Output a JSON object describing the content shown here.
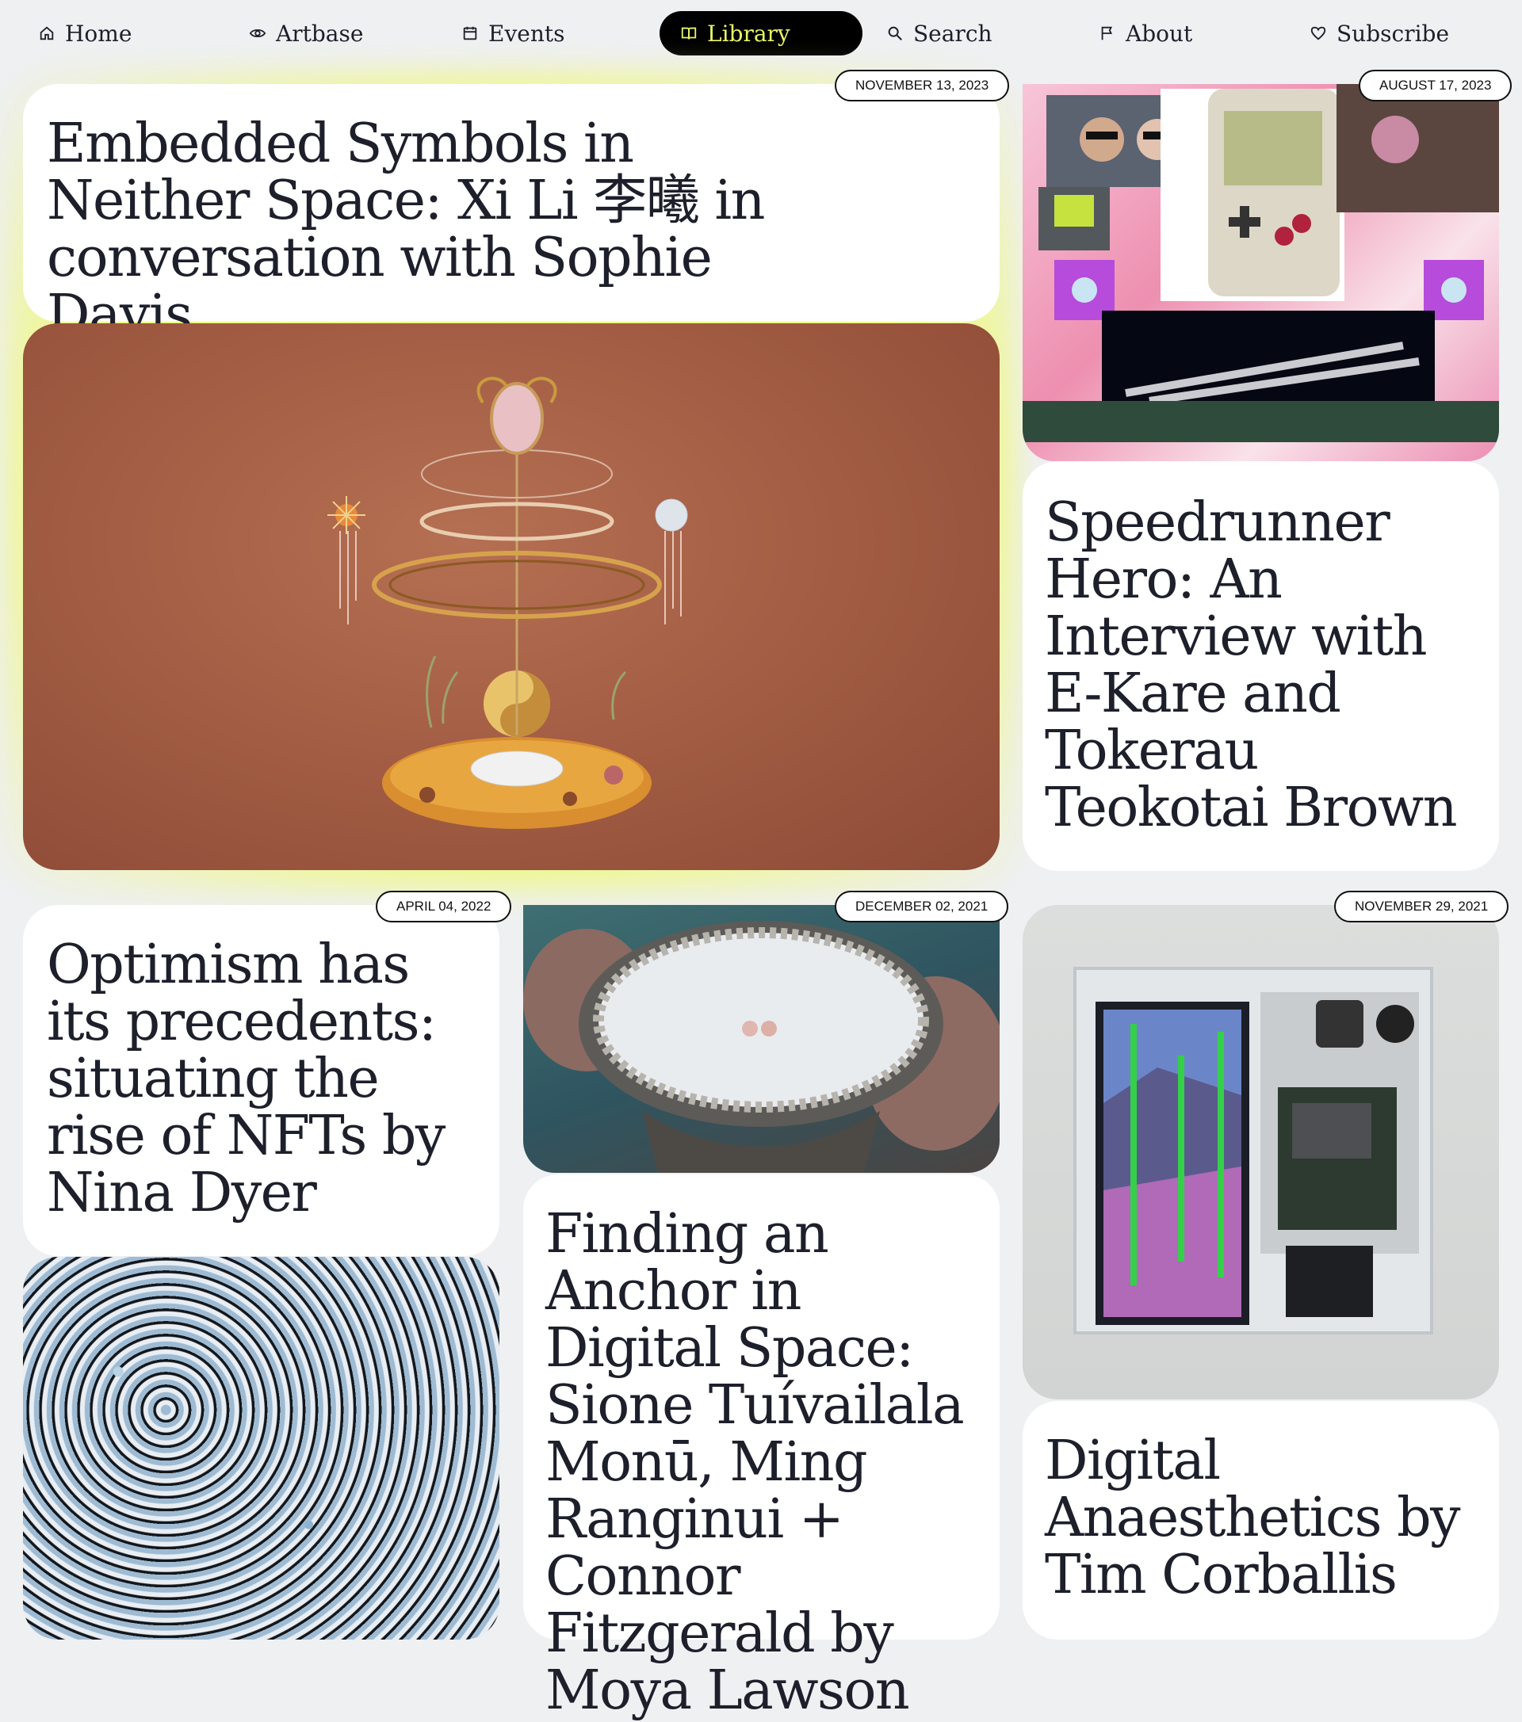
{
  "nav": {
    "items": [
      {
        "label": "Home",
        "icon": "home-icon"
      },
      {
        "label": "Artbase",
        "icon": "eye-icon"
      },
      {
        "label": "Events",
        "icon": "calendar-icon"
      },
      {
        "label": "Library",
        "icon": "book-icon",
        "active": true
      },
      {
        "label": "Search",
        "icon": "search-icon"
      },
      {
        "label": "About",
        "icon": "flag-icon"
      },
      {
        "label": "Subscribe",
        "icon": "heart-icon"
      }
    ]
  },
  "articles": [
    {
      "date": "NOVEMBER 13, 2023",
      "title": "Embedded Symbols in Neither Space: Xi Li 李曦 in conversation with Sophie Davis"
    },
    {
      "date": "AUGUST 17, 2023",
      "title": "Speedrunner Hero: An Interview with E-Kare and Tokerau Teokotai Brown"
    },
    {
      "date": "APRIL 04, 2022",
      "title": "Optimism has its precedents: situating the rise of NFTs by Nina Dyer"
    },
    {
      "date": "DECEMBER 02, 2021",
      "title": "Finding an Anchor in Digital Space: Sione Tuívailala Monū, Ming Ranginui + Connor Fitzgerald by Moya Lawson"
    },
    {
      "date": "NOVEMBER 29, 2021",
      "title": "Digital Anaesthetics by Tim Corballis"
    }
  ],
  "colors": {
    "accent": "#e8f56a",
    "background": "#eff0f2",
    "text": "#1d1f2b"
  }
}
